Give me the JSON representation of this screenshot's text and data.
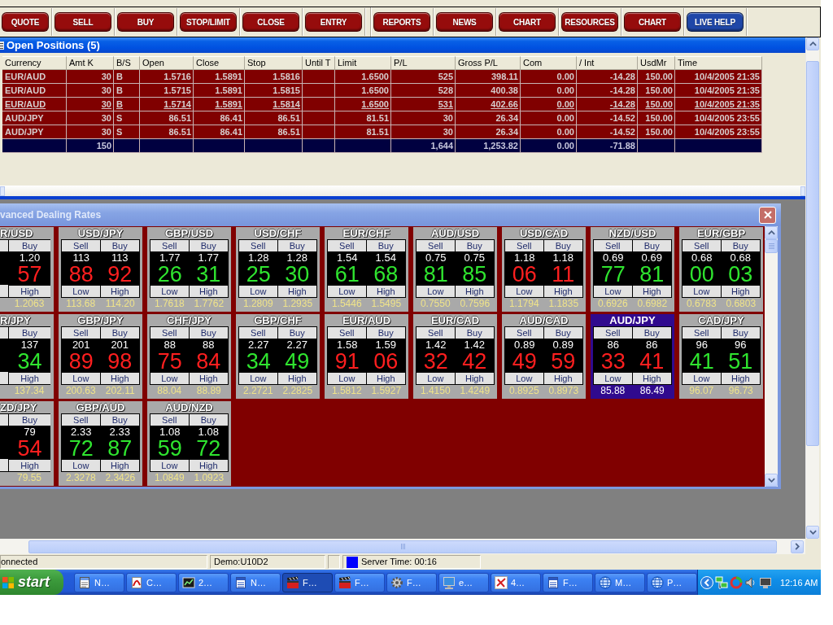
{
  "toolbar": {
    "groups": [
      {
        "buttons": [
          {
            "label": "QUOTE",
            "color": "#960c0c"
          },
          {
            "label": "SELL",
            "color": "#960c0c"
          },
          {
            "label": "BUY",
            "color": "#960c0c"
          },
          {
            "label": "STOP/LIMIT",
            "color": "#960c0c"
          },
          {
            "label": "CLOSE",
            "color": "#960c0c"
          },
          {
            "label": "ENTRY",
            "color": "#960c0c"
          }
        ]
      },
      {
        "buttons": [
          {
            "label": "REPORTS",
            "color": "#960c0c"
          },
          {
            "label": "NEWS",
            "color": "#960c0c"
          },
          {
            "label": "CHART",
            "color": "#960c0c"
          },
          {
            "label": "RESOURCES",
            "color": "#960c0c"
          },
          {
            "label": "CHART",
            "color": "#960c0c"
          },
          {
            "label": "LIVE HELP",
            "color": "#1f47a8"
          }
        ]
      }
    ]
  },
  "positions": {
    "title": "Open Positions (5)",
    "columns": [
      "Currency",
      "Amt K",
      "B/S",
      "Open",
      "Close",
      "Stop",
      "Until T",
      "Limit",
      "P/L",
      "Gross P/L",
      "Com",
      "/ Int",
      "UsdMr",
      "Time"
    ],
    "rows": [
      {
        "currency": "EUR/AUD",
        "amt_k": "30",
        "side": "B",
        "open": "1.5716",
        "close": "1.5891",
        "stop": "1.5816",
        "limit": "1.6500",
        "pl": "525",
        "gross_pl": "398.11",
        "com": "0.00",
        "int": "-14.28",
        "usd_mr": "150.00",
        "time": "10/4/2005 21:35",
        "selected": false
      },
      {
        "currency": "EUR/AUD",
        "amt_k": "30",
        "side": "B",
        "open": "1.5715",
        "close": "1.5891",
        "stop": "1.5815",
        "limit": "1.6500",
        "pl": "528",
        "gross_pl": "400.38",
        "com": "0.00",
        "int": "-14.28",
        "usd_mr": "150.00",
        "time": "10/4/2005 21:35",
        "selected": false
      },
      {
        "currency": "EUR/AUD",
        "amt_k": "30",
        "side": "B",
        "open": "1.5714",
        "close": "1.5891",
        "stop": "1.5814",
        "limit": "1.6500",
        "pl": "531",
        "gross_pl": "402.66",
        "com": "0.00",
        "int": "-14.28",
        "usd_mr": "150.00",
        "time": "10/4/2005 21:35",
        "selected": true
      },
      {
        "currency": "AUD/JPY",
        "amt_k": "30",
        "side": "S",
        "open": "86.51",
        "close": "86.41",
        "stop": "86.51",
        "limit": "81.51",
        "pl": "30",
        "gross_pl": "26.34",
        "com": "0.00",
        "int": "-14.52",
        "usd_mr": "150.00",
        "time": "10/4/2005 23:55",
        "selected": false
      },
      {
        "currency": "AUD/JPY",
        "amt_k": "30",
        "side": "S",
        "open": "86.51",
        "close": "86.41",
        "stop": "86.51",
        "limit": "81.51",
        "pl": "30",
        "gross_pl": "26.34",
        "com": "0.00",
        "int": "-14.52",
        "usd_mr": "150.00",
        "time": "10/4/2005 23:55",
        "selected": false
      }
    ],
    "total": {
      "amt_k": "150",
      "pl": "1,644",
      "gross_pl": "1,253.82",
      "com": "0.00",
      "int": "-71.88"
    }
  },
  "dealing_rates": {
    "title": "vanced Dealing Rates",
    "rows": [
      {
        "tiles": [
          {
            "kind": "partial",
            "pair": "R/USD",
            "selected": false,
            "rising": false,
            "buy": {
              "label": "Buy",
              "figure": "1.20",
              "pips": "57"
            },
            "high": {
              "label": "High",
              "value": "1.2063"
            }
          },
          {
            "kind": "full",
            "pair": "USD/JPY",
            "selected": false,
            "rising": false,
            "sell": {
              "label": "Sell",
              "figure": "113",
              "pips": "88"
            },
            "buy": {
              "label": "Buy",
              "figure": "113",
              "pips": "92"
            },
            "low": {
              "label": "Low",
              "value": "113.68"
            },
            "high": {
              "label": "High",
              "value": "114.20"
            }
          },
          {
            "kind": "full",
            "pair": "GBP/USD",
            "selected": false,
            "rising": true,
            "sell": {
              "label": "Sell",
              "figure": "1.77",
              "pips": "26"
            },
            "buy": {
              "label": "Buy",
              "figure": "1.77",
              "pips": "31"
            },
            "low": {
              "label": "Low",
              "value": "1.7618"
            },
            "high": {
              "label": "High",
              "value": "1.7762"
            }
          },
          {
            "kind": "full",
            "pair": "USD/CHF",
            "selected": false,
            "rising": true,
            "sell": {
              "label": "Sell",
              "figure": "1.28",
              "pips": "25"
            },
            "buy": {
              "label": "Buy",
              "figure": "1.28",
              "pips": "30"
            },
            "low": {
              "label": "Low",
              "value": "1.2809"
            },
            "high": {
              "label": "High",
              "value": "1.2935"
            }
          },
          {
            "kind": "full",
            "pair": "EUR/CHF",
            "selected": false,
            "rising": true,
            "sell": {
              "label": "Sell",
              "figure": "1.54",
              "pips": "61"
            },
            "buy": {
              "label": "Buy",
              "figure": "1.54",
              "pips": "68"
            },
            "low": {
              "label": "Low",
              "value": "1.5446"
            },
            "high": {
              "label": "High",
              "value": "1.5495"
            }
          },
          {
            "kind": "full",
            "pair": "AUD/USD",
            "selected": false,
            "rising": true,
            "sell": {
              "label": "Sell",
              "figure": "0.75",
              "pips": "81"
            },
            "buy": {
              "label": "Buy",
              "figure": "0.75",
              "pips": "85"
            },
            "low": {
              "label": "Low",
              "value": "0.7550"
            },
            "high": {
              "label": "High",
              "value": "0.7596"
            }
          },
          {
            "kind": "full",
            "pair": "USD/CAD",
            "selected": false,
            "rising": false,
            "sell": {
              "label": "Sell",
              "figure": "1.18",
              "pips": "06"
            },
            "buy": {
              "label": "Buy",
              "figure": "1.18",
              "pips": "11"
            },
            "low": {
              "label": "Low",
              "value": "1.1794"
            },
            "high": {
              "label": "High",
              "value": "1.1835"
            }
          },
          {
            "kind": "full",
            "pair": "NZD/USD",
            "selected": false,
            "rising": true,
            "sell": {
              "label": "Sell",
              "figure": "0.69",
              "pips": "77"
            },
            "buy": {
              "label": "Buy",
              "figure": "0.69",
              "pips": "81"
            },
            "low": {
              "label": "Low",
              "value": "0.6926"
            },
            "high": {
              "label": "High",
              "value": "0.6982"
            }
          },
          {
            "kind": "full",
            "pair": "EUR/GBP",
            "selected": false,
            "rising": true,
            "sell": {
              "label": "Sell",
              "figure": "0.68",
              "pips": "00"
            },
            "buy": {
              "label": "Buy",
              "figure": "0.68",
              "pips": "03"
            },
            "low": {
              "label": "Low",
              "value": "0.6783"
            },
            "high": {
              "label": "High",
              "value": "0.6803"
            }
          }
        ]
      },
      {
        "tiles": [
          {
            "kind": "partial",
            "pair": "R/JPY",
            "selected": false,
            "rising": true,
            "buy": {
              "label": "Buy",
              "figure": "137",
              "pips": "34"
            },
            "high": {
              "label": "High",
              "value": "137.34"
            }
          },
          {
            "kind": "full",
            "pair": "GBP/JPY",
            "selected": false,
            "rising": false,
            "sell": {
              "label": "Sell",
              "figure": "201",
              "pips": "89"
            },
            "buy": {
              "label": "Buy",
              "figure": "201",
              "pips": "98"
            },
            "low": {
              "label": "Low",
              "value": "200.63"
            },
            "high": {
              "label": "High",
              "value": "202.11"
            }
          },
          {
            "kind": "full",
            "pair": "CHF/JPY",
            "selected": false,
            "rising": false,
            "sell": {
              "label": "Sell",
              "figure": "88",
              "pips": "75"
            },
            "buy": {
              "label": "Buy",
              "figure": "88",
              "pips": "84"
            },
            "low": {
              "label": "Low",
              "value": "88.04"
            },
            "high": {
              "label": "High",
              "value": "88.89"
            }
          },
          {
            "kind": "full",
            "pair": "GBP/CHF",
            "selected": false,
            "rising": true,
            "sell": {
              "label": "Sell",
              "figure": "2.27",
              "pips": "34"
            },
            "buy": {
              "label": "Buy",
              "figure": "2.27",
              "pips": "49"
            },
            "low": {
              "label": "Low",
              "value": "2.2721"
            },
            "high": {
              "label": "High",
              "value": "2.2825"
            }
          },
          {
            "kind": "full",
            "pair": "EUR/AUD",
            "selected": false,
            "rising": false,
            "sell": {
              "label": "Sell",
              "figure": "1.58",
              "pips": "91"
            },
            "buy": {
              "label": "Buy",
              "figure": "1.59",
              "pips": "06"
            },
            "low": {
              "label": "Low",
              "value": "1.5812"
            },
            "high": {
              "label": "High",
              "value": "1.5927"
            }
          },
          {
            "kind": "full",
            "pair": "EUR/CAD",
            "selected": false,
            "rising": false,
            "sell": {
              "label": "Sell",
              "figure": "1.42",
              "pips": "32"
            },
            "buy": {
              "label": "Buy",
              "figure": "1.42",
              "pips": "42"
            },
            "low": {
              "label": "Low",
              "value": "1.4150"
            },
            "high": {
              "label": "High",
              "value": "1.4249"
            }
          },
          {
            "kind": "full",
            "pair": "AUD/CAD",
            "selected": false,
            "rising": false,
            "sell": {
              "label": "Sell",
              "figure": "0.89",
              "pips": "49"
            },
            "buy": {
              "label": "Buy",
              "figure": "0.89",
              "pips": "59"
            },
            "low": {
              "label": "Low",
              "value": "0.8925"
            },
            "high": {
              "label": "High",
              "value": "0.8973"
            }
          },
          {
            "kind": "full",
            "pair": "AUD/JPY",
            "selected": true,
            "rising": false,
            "sell": {
              "label": "Sell",
              "figure": "86",
              "pips": "33"
            },
            "buy": {
              "label": "Buy",
              "figure": "86",
              "pips": "41"
            },
            "low": {
              "label": "Low",
              "value": "85.88"
            },
            "high": {
              "label": "High",
              "value": "86.49"
            }
          },
          {
            "kind": "full",
            "pair": "CAD/JPY",
            "selected": false,
            "rising": true,
            "sell": {
              "label": "Sell",
              "figure": "96",
              "pips": "41"
            },
            "buy": {
              "label": "Buy",
              "figure": "96",
              "pips": "51"
            },
            "low": {
              "label": "Low",
              "value": "96.07"
            },
            "high": {
              "label": "High",
              "value": "96.73"
            }
          }
        ]
      },
      {
        "tiles": [
          {
            "kind": "partial",
            "pair": "ZD/JPY",
            "selected": false,
            "rising": false,
            "buy": {
              "label": "Buy",
              "figure": "79",
              "pips": "54"
            },
            "high": {
              "label": "High",
              "value": "79.55"
            }
          },
          {
            "kind": "full",
            "pair": "GBP/AUD",
            "selected": false,
            "rising": true,
            "sell": {
              "label": "Sell",
              "figure": "2.33",
              "pips": "72"
            },
            "buy": {
              "label": "Buy",
              "figure": "2.33",
              "pips": "87"
            },
            "low": {
              "label": "Low",
              "value": "2.3278"
            },
            "high": {
              "label": "High",
              "value": "2.3426"
            }
          },
          {
            "kind": "full",
            "pair": "AUD/NZD",
            "selected": false,
            "rising": true,
            "sell": {
              "label": "Sell",
              "figure": "1.08",
              "pips": "59"
            },
            "buy": {
              "label": "Buy",
              "figure": "1.08",
              "pips": "72"
            },
            "low": {
              "label": "Low",
              "value": "1.0849"
            },
            "high": {
              "label": "High",
              "value": "1.0923"
            }
          }
        ]
      }
    ]
  },
  "status_bar": {
    "connection": "onnected",
    "account": "Demo:U10D2",
    "server_time": "Server Time: 00:16"
  },
  "taskbar": {
    "start": "start",
    "tasks": [
      {
        "label": "N…",
        "selected": false
      },
      {
        "label": "C…",
        "selected": false
      },
      {
        "label": "2…",
        "selected": false
      },
      {
        "label": "N…",
        "selected": false
      },
      {
        "label": "F…",
        "selected": true
      },
      {
        "label": "F…",
        "selected": false
      },
      {
        "label": "F…",
        "selected": false
      },
      {
        "label": "e…",
        "selected": false
      },
      {
        "label": "4…",
        "selected": false
      },
      {
        "label": "F…",
        "selected": false
      },
      {
        "label": "M…",
        "selected": false
      },
      {
        "label": "P…",
        "selected": false
      }
    ],
    "clock": "12:16 AM"
  }
}
